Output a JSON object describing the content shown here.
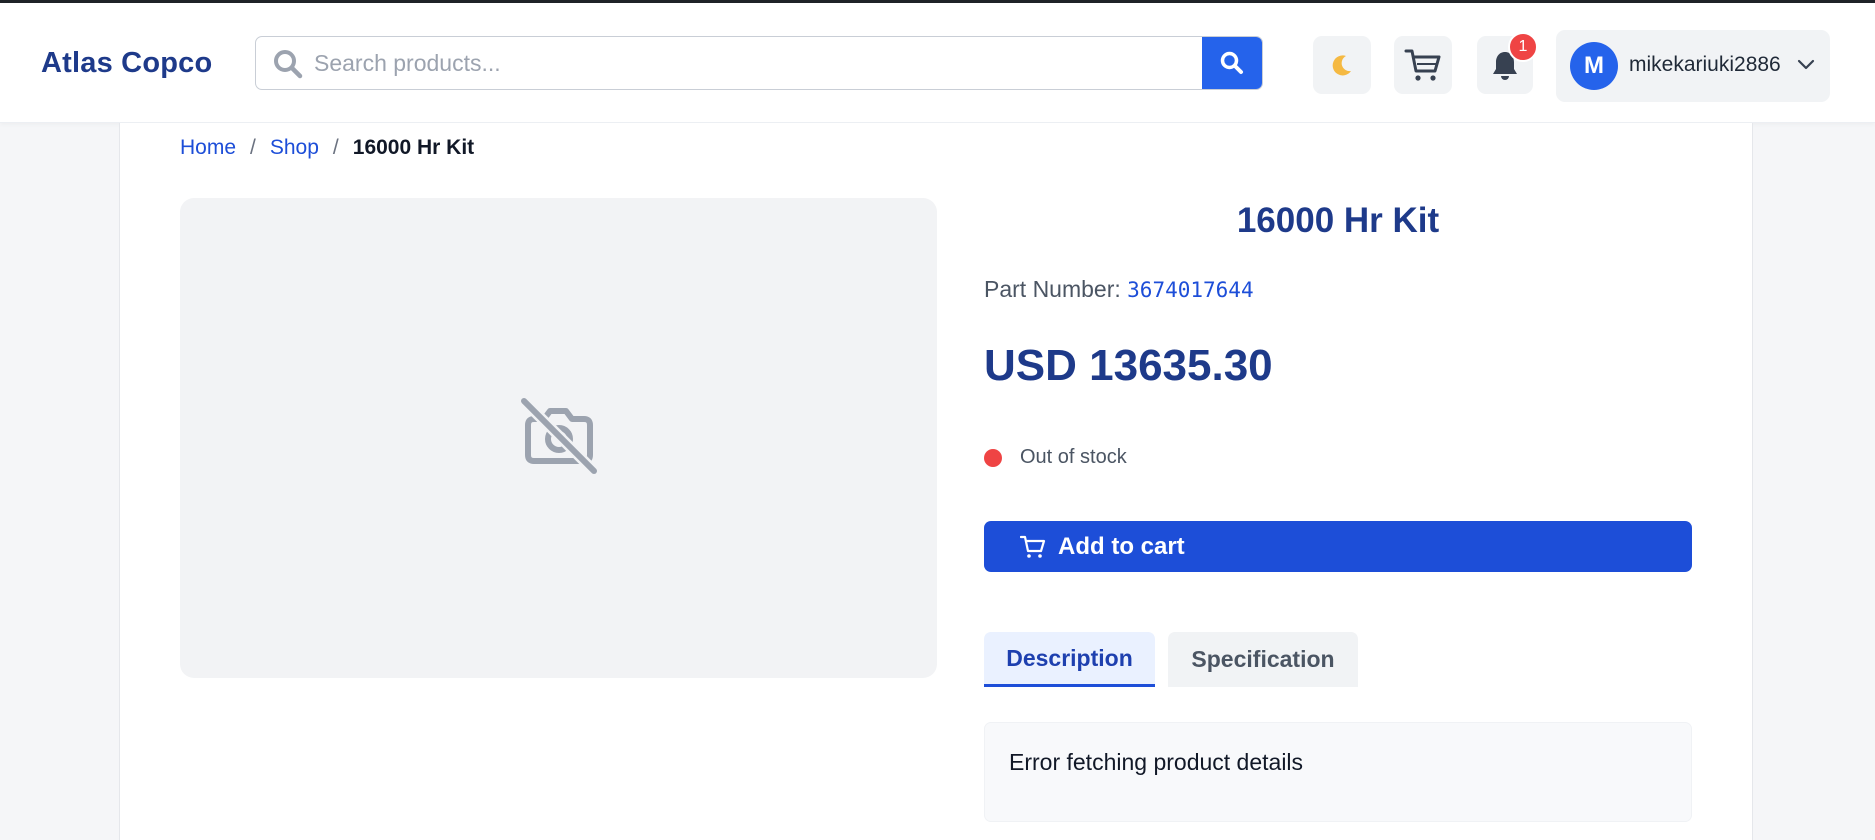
{
  "brand": {
    "name": "Atlas Copco"
  },
  "search": {
    "placeholder": "Search products..."
  },
  "header": {
    "notification_count": "1",
    "user": {
      "initial": "M",
      "username": "mikekariuki2886"
    }
  },
  "breadcrumb": {
    "home": "Home",
    "shop": "Shop",
    "current": "16000 Hr Kit",
    "separator": "/"
  },
  "product": {
    "title": "16000 Hr Kit",
    "part_number_label": "Part Number:",
    "part_number": "3674017644",
    "price": "USD 13635.30",
    "stock_status": "Out of stock",
    "add_to_cart_label": "Add to cart"
  },
  "tabs": [
    {
      "label": "Description",
      "active": true
    },
    {
      "label": "Specification",
      "active": false
    }
  ],
  "description": {
    "text": "Error fetching product details"
  },
  "colors": {
    "primary": "#1d4ed8",
    "brand": "#1e3a8a",
    "out_of_stock": "#ef4444"
  },
  "icons": [
    "search-icon",
    "moon-icon",
    "cart-icon",
    "bell-icon",
    "chevron-down-icon",
    "no-image-icon"
  ]
}
